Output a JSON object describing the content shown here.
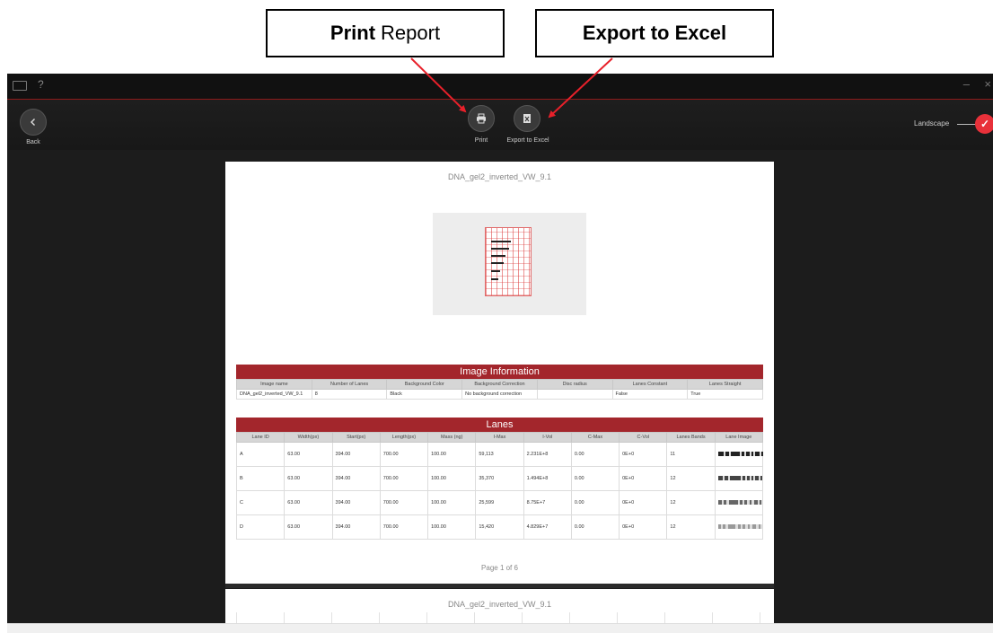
{
  "callouts": {
    "print": {
      "bold": "Print",
      "rest": "Report"
    },
    "export": {
      "text": "Export to Excel"
    }
  },
  "titlebar": {
    "help": "?",
    "minimize": "–",
    "close": "×"
  },
  "toolbar": {
    "back_label": "Back",
    "print_label": "Print",
    "export_label": "Export to Excel",
    "landscape_label": "Landscape",
    "landscape_on": true
  },
  "page": {
    "title": "DNA_gel2_inverted_VW_9.1",
    "image_info": {
      "heading": "Image Information",
      "headers": [
        "Image name",
        "Number of Lanes",
        "Background Color",
        "Background Correction",
        "Disc radius",
        "Lanes Constant",
        "Lanes Straight"
      ],
      "row": [
        "DNA_gel2_inverted_VW_9.1",
        "8",
        "Black",
        "No background correction",
        "",
        "False",
        "True"
      ]
    },
    "lanes": {
      "heading": "Lanes",
      "headers": [
        "Lane ID",
        "Width(px)",
        "Start(px)",
        "Length(px)",
        "Mass (ng)",
        "I-Max",
        "I-Vol",
        "C-Max",
        "C-Vol",
        "Lanes Bands",
        "Lane Image"
      ],
      "rows": [
        [
          "A",
          "63.00",
          "394.00",
          "700.00",
          "100.00",
          "59,113",
          "2.231E+8",
          "0.00",
          "0E+0",
          "11"
        ],
        [
          "B",
          "63.00",
          "394.00",
          "700.00",
          "100.00",
          "35,370",
          "1.494E+8",
          "0.00",
          "0E+0",
          "12"
        ],
        [
          "C",
          "63.00",
          "394.00",
          "700.00",
          "100.00",
          "25,599",
          "8.75E+7",
          "0.00",
          "0E+0",
          "12"
        ],
        [
          "D",
          "63.00",
          "394.00",
          "700.00",
          "100.00",
          "15,420",
          "4.829E+7",
          "0.00",
          "0E+0",
          "12"
        ]
      ]
    },
    "page_number": "Page 1 of 6"
  },
  "page2": {
    "title": "DNA_gel2_inverted_VW_9.1"
  },
  "colors": {
    "accent": "#a3262c",
    "toggle": "#e8313a",
    "arrow": "#e8202a"
  }
}
